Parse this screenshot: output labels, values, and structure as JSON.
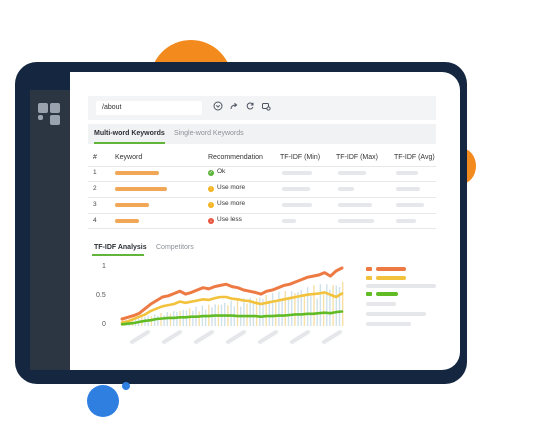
{
  "colors": {
    "accent_green": "#62b43a",
    "keyword_orange": "#f2a756",
    "line_red_orange": "#ee7a43",
    "line_yellow": "#f2c23d",
    "line_green": "#60bb25",
    "status_ok": "#5bb33a",
    "status_more": "#f2b320",
    "status_less": "#e8553e"
  },
  "toolbar": {
    "url_value": "/about",
    "icons": [
      "save-icon",
      "share-icon",
      "refresh-icon",
      "settings-icon"
    ]
  },
  "keyword_tabs": [
    {
      "label": "Multi-word Keywords",
      "active": true
    },
    {
      "label": "Single-word Keywords",
      "active": false
    }
  ],
  "table": {
    "headers": [
      "#",
      "Keyword",
      "Recommendation",
      "TF-IDF (Min)",
      "TF-IDF (Max)",
      "TF-IDF (Avg)"
    ],
    "rows": [
      {
        "num": "1",
        "rec": "Ok",
        "status": "ok"
      },
      {
        "num": "2",
        "rec": "Use more",
        "status": "more"
      },
      {
        "num": "3",
        "rec": "Use more",
        "status": "more"
      },
      {
        "num": "4",
        "rec": "Use less",
        "status": "less"
      }
    ]
  },
  "analysis_tabs": [
    {
      "label": "TF-IDF Analysis",
      "active": true
    },
    {
      "label": "Competitors",
      "active": false
    }
  ],
  "chart_data": {
    "type": "line",
    "ytick_labels": [
      "1",
      "0.5",
      "0"
    ],
    "ylim": [
      0,
      1
    ],
    "series": [
      {
        "color": "#ee7a43",
        "values": [
          0.12,
          0.15,
          0.18,
          0.22,
          0.3,
          0.38,
          0.44,
          0.5,
          0.52,
          0.56,
          0.6,
          0.55,
          0.58,
          0.62,
          0.66,
          0.64,
          0.68,
          0.7,
          0.72,
          0.68,
          0.66,
          0.62,
          0.6,
          0.58,
          0.55,
          0.6,
          0.62,
          0.66,
          0.7,
          0.72,
          0.76,
          0.8,
          0.84,
          0.86,
          0.88,
          0.92,
          0.86,
          0.95,
          1.0
        ]
      },
      {
        "color": "#f2c23d",
        "values": [
          0.06,
          0.08,
          0.12,
          0.16,
          0.2,
          0.26,
          0.3,
          0.34,
          0.36,
          0.38,
          0.42,
          0.4,
          0.42,
          0.44,
          0.46,
          0.45,
          0.48,
          0.5,
          0.5,
          0.47,
          0.46,
          0.44,
          0.43,
          0.4,
          0.38,
          0.4,
          0.42,
          0.44,
          0.46,
          0.48,
          0.5,
          0.52,
          0.54,
          0.55,
          0.56,
          0.58,
          0.54,
          0.5,
          0.56
        ]
      },
      {
        "color": "#60bb25",
        "values": [
          0.03,
          0.04,
          0.05,
          0.07,
          0.09,
          0.1,
          0.12,
          0.13,
          0.14,
          0.14,
          0.15,
          0.15,
          0.16,
          0.16,
          0.17,
          0.17,
          0.18,
          0.18,
          0.18,
          0.18,
          0.17,
          0.17,
          0.17,
          0.17,
          0.16,
          0.17,
          0.17,
          0.18,
          0.18,
          0.19,
          0.2,
          0.2,
          0.21,
          0.21,
          0.22,
          0.23,
          0.22,
          0.24,
          0.25
        ]
      }
    ]
  }
}
